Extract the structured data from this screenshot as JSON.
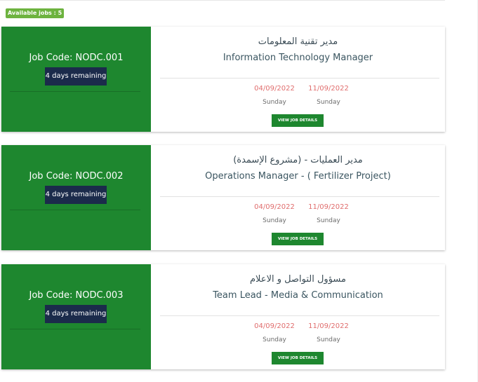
{
  "header": {
    "available_jobs": "Available jobs : 5"
  },
  "jobs": [
    {
      "code": "Job Code: NODC.001",
      "remaining": "4 days remaining",
      "title_ar": "مدير تقنية المعلومات",
      "title_en": "Information Technology Manager",
      "start_date": "04/09/2022",
      "end_date": "11/09/2022",
      "start_day": "Sunday",
      "end_day": "Sunday",
      "button_label": "VIEW JOB DETAILS"
    },
    {
      "code": "Job Code: NODC.002",
      "remaining": "4 days remaining",
      "title_ar": "مدير العمليات - (مشروع الإسمدة)",
      "title_en": "Operations Manager - ( Fertilizer Project)",
      "start_date": "04/09/2022",
      "end_date": "11/09/2022",
      "start_day": "Sunday",
      "end_day": "Sunday",
      "button_label": "VIEW JOB DETAILS"
    },
    {
      "code": "Job Code: NODC.003",
      "remaining": "4 days remaining",
      "title_ar": "مسؤول التواصل و الاعلام",
      "title_en": "Team Lead - Media & Communication",
      "start_date": "04/09/2022",
      "end_date": "11/09/2022",
      "start_day": "Sunday",
      "end_day": "Sunday",
      "button_label": "VIEW JOB DETAILS"
    }
  ],
  "colors": {
    "brand_green": "#1e872f",
    "badge_green": "#6db33f",
    "remaining_navy": "#1b2b4b",
    "date_red": "#e06d6d"
  }
}
